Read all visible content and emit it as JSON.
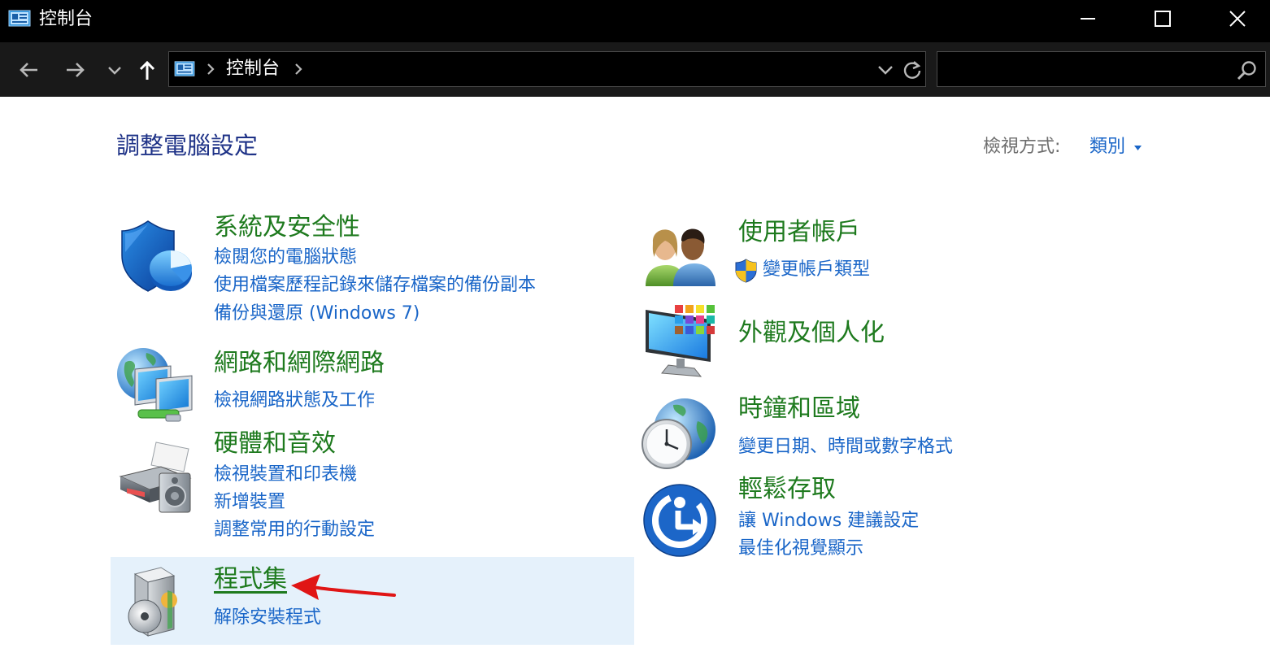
{
  "window": {
    "title": "控制台",
    "app_icon": "control-panel-icon",
    "controls": [
      "minimize-icon",
      "maximize-icon",
      "close-icon"
    ]
  },
  "address_bar": {
    "breadcrumb": "控制台",
    "search_placeholder": ""
  },
  "header": {
    "title": "調整電腦設定",
    "view_by_label": "檢視方式:",
    "view_by_value": "類別"
  },
  "left_column": [
    {
      "title": "系統及安全性",
      "icon": "security-shield-icon",
      "links": [
        "檢閱您的電腦狀態",
        "使用檔案歷程記錄來儲存檔案的備份副本",
        "備份與還原 (Windows 7)"
      ]
    },
    {
      "title": "網路和網際網路",
      "icon": "network-globe-icon",
      "links": [
        "檢視網路狀態及工作"
      ]
    },
    {
      "title": "硬體和音效",
      "icon": "printer-speaker-icon",
      "links": [
        "檢視裝置和印表機",
        "新增裝置",
        "調整常用的行動設定"
      ]
    },
    {
      "title": "程式集",
      "icon": "programs-box-icon",
      "links": [
        "解除安裝程式"
      ],
      "highlighted": true
    }
  ],
  "right_column": [
    {
      "title": "使用者帳戶",
      "icon": "users-icon",
      "links": [
        "變更帳戶類型"
      ],
      "link_icon": "uac-shield-icon"
    },
    {
      "title": "外觀及個人化",
      "icon": "monitor-palette-icon",
      "links": []
    },
    {
      "title": "時鐘和區域",
      "icon": "clock-globe-icon",
      "links": [
        "變更日期、時間或數字格式"
      ]
    },
    {
      "title": "輕鬆存取",
      "icon": "ease-of-access-icon",
      "links": [
        "讓 Windows 建議設定",
        "最佳化視覺顯示"
      ]
    }
  ],
  "annotation": {
    "icon": "red-arrow-icon",
    "color": "#e01515"
  }
}
